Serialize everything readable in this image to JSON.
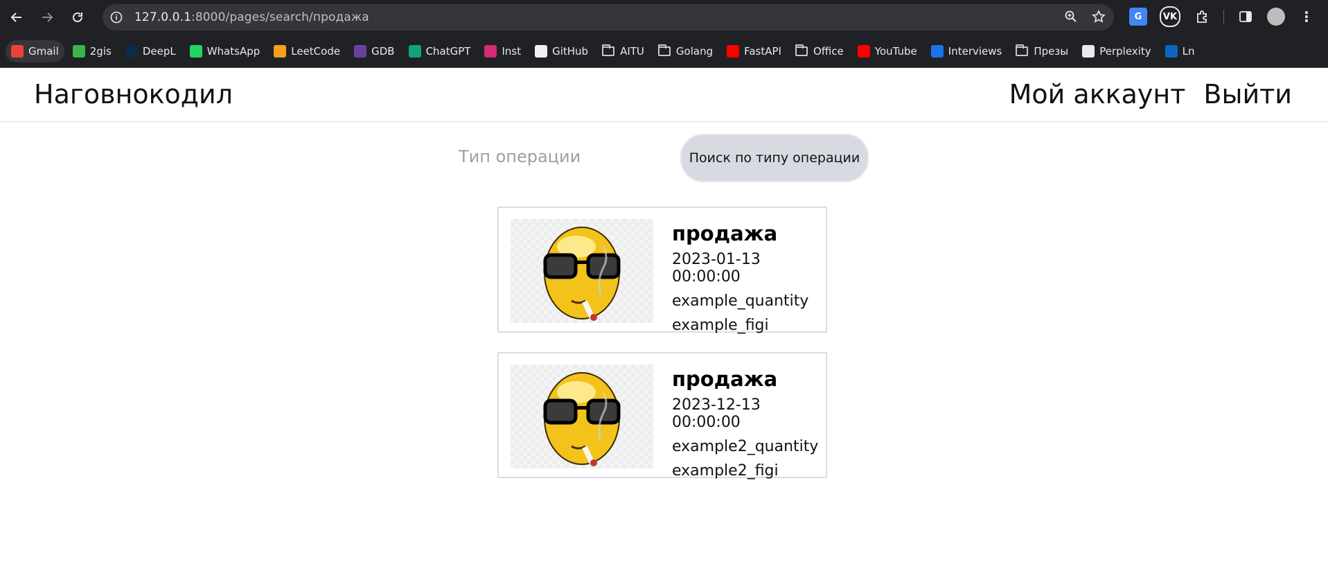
{
  "browser": {
    "url_host": "127.0.0.1",
    "url_rest": ":8000/pages/search/продажа"
  },
  "bookmarks": [
    {
      "label": "Gmail",
      "icon": "gmail-icon",
      "color": "#ea4335"
    },
    {
      "label": "2gis",
      "icon": "2gis-icon",
      "color": "#3bb54a"
    },
    {
      "label": "DeepL",
      "icon": "deepl-icon",
      "color": "#0f2b46"
    },
    {
      "label": "WhatsApp",
      "icon": "whatsapp-icon",
      "color": "#25d366"
    },
    {
      "label": "LeetCode",
      "icon": "leetcode-icon",
      "color": "#f89f1b"
    },
    {
      "label": "GDB",
      "icon": "gdb-icon",
      "color": "#6b3fa0"
    },
    {
      "label": "ChatGPT",
      "icon": "chatgpt-icon",
      "color": "#10a37f"
    },
    {
      "label": "Inst",
      "icon": "instagram-icon",
      "color": "#d62976"
    },
    {
      "label": "GitHub",
      "icon": "github-icon",
      "color": "#f0f0f0"
    },
    {
      "label": "AITU",
      "icon": "folder-icon"
    },
    {
      "label": "Golang",
      "icon": "folder-icon"
    },
    {
      "label": "FastAPI",
      "icon": "youtube-icon",
      "color": "#ff0000"
    },
    {
      "label": "Office",
      "icon": "folder-icon"
    },
    {
      "label": "YouTube",
      "icon": "youtube-icon",
      "color": "#ff0000"
    },
    {
      "label": "Interviews",
      "icon": "interviews-icon",
      "color": "#1a73e8"
    },
    {
      "label": "Презы",
      "icon": "folder-icon"
    },
    {
      "label": "Perplexity",
      "icon": "perplexity-icon",
      "color": "#e8eaed"
    },
    {
      "label": "Ln",
      "icon": "linkedin-icon",
      "color": "#0a66c2"
    }
  ],
  "site": {
    "brand": "Наговнокодил",
    "nav": {
      "account": "Мой аккаунт",
      "logout": "Выйти"
    }
  },
  "search": {
    "placeholder": "Тип операции",
    "button": "Поиск по типу операции"
  },
  "results": [
    {
      "title": "продажа",
      "date": "2023-01-13 00:00:00",
      "quantity": "example_quantity",
      "figi": "example_figi"
    },
    {
      "title": "продажа",
      "date": "2023-12-13 00:00:00",
      "quantity": "example2_quantity",
      "figi": "example2_figi"
    }
  ]
}
